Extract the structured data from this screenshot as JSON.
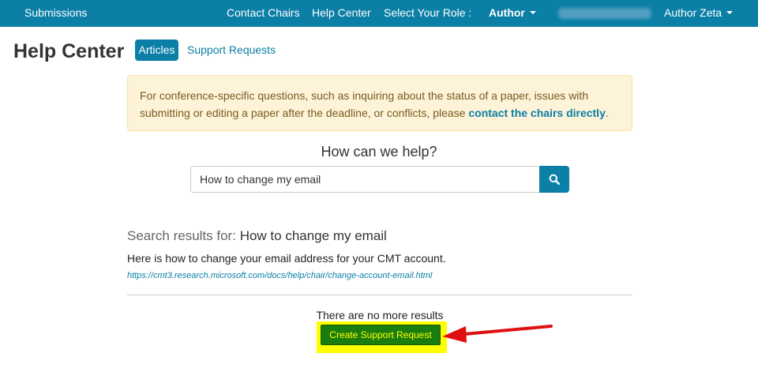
{
  "topnav": {
    "submissions": "Submissions",
    "contact_chairs": "Contact Chairs",
    "help_center": "Help Center",
    "select_role_label": "Select Your Role :",
    "role_value": "Author",
    "user_name": "Author Zeta",
    "bg_color": "#0b7fa6"
  },
  "page": {
    "title": "Help Center",
    "tabs": [
      {
        "label": "Articles",
        "active": true
      },
      {
        "label": "Support Requests",
        "active": false
      }
    ]
  },
  "alert": {
    "text_before": "For conference-specific questions, such as inquiring about the status of a paper, issues with submitting or editing a paper after the deadline, or conflicts, please ",
    "link_text": "contact the chairs directly",
    "text_after": "."
  },
  "search": {
    "heading": "How can we help?",
    "value": "How to change my email",
    "button_icon": "search-icon"
  },
  "results": {
    "label_prefix": "Search results for:",
    "query": "How to change my email",
    "items": [
      {
        "title": "Here is how to change your email address for your CMT account.",
        "url": "https://cmt3.research.microsoft.com/docs/help/chair/change-account-email.html"
      }
    ],
    "no_more": "There are no more results",
    "create_button": "Create Support Request"
  },
  "colors": {
    "accent": "#0b7fa6",
    "alert_bg": "#fcf3d8",
    "highlight": "#ffff00",
    "create_button_bg": "#1a7d10",
    "annotation_arrow": "#e01010"
  }
}
